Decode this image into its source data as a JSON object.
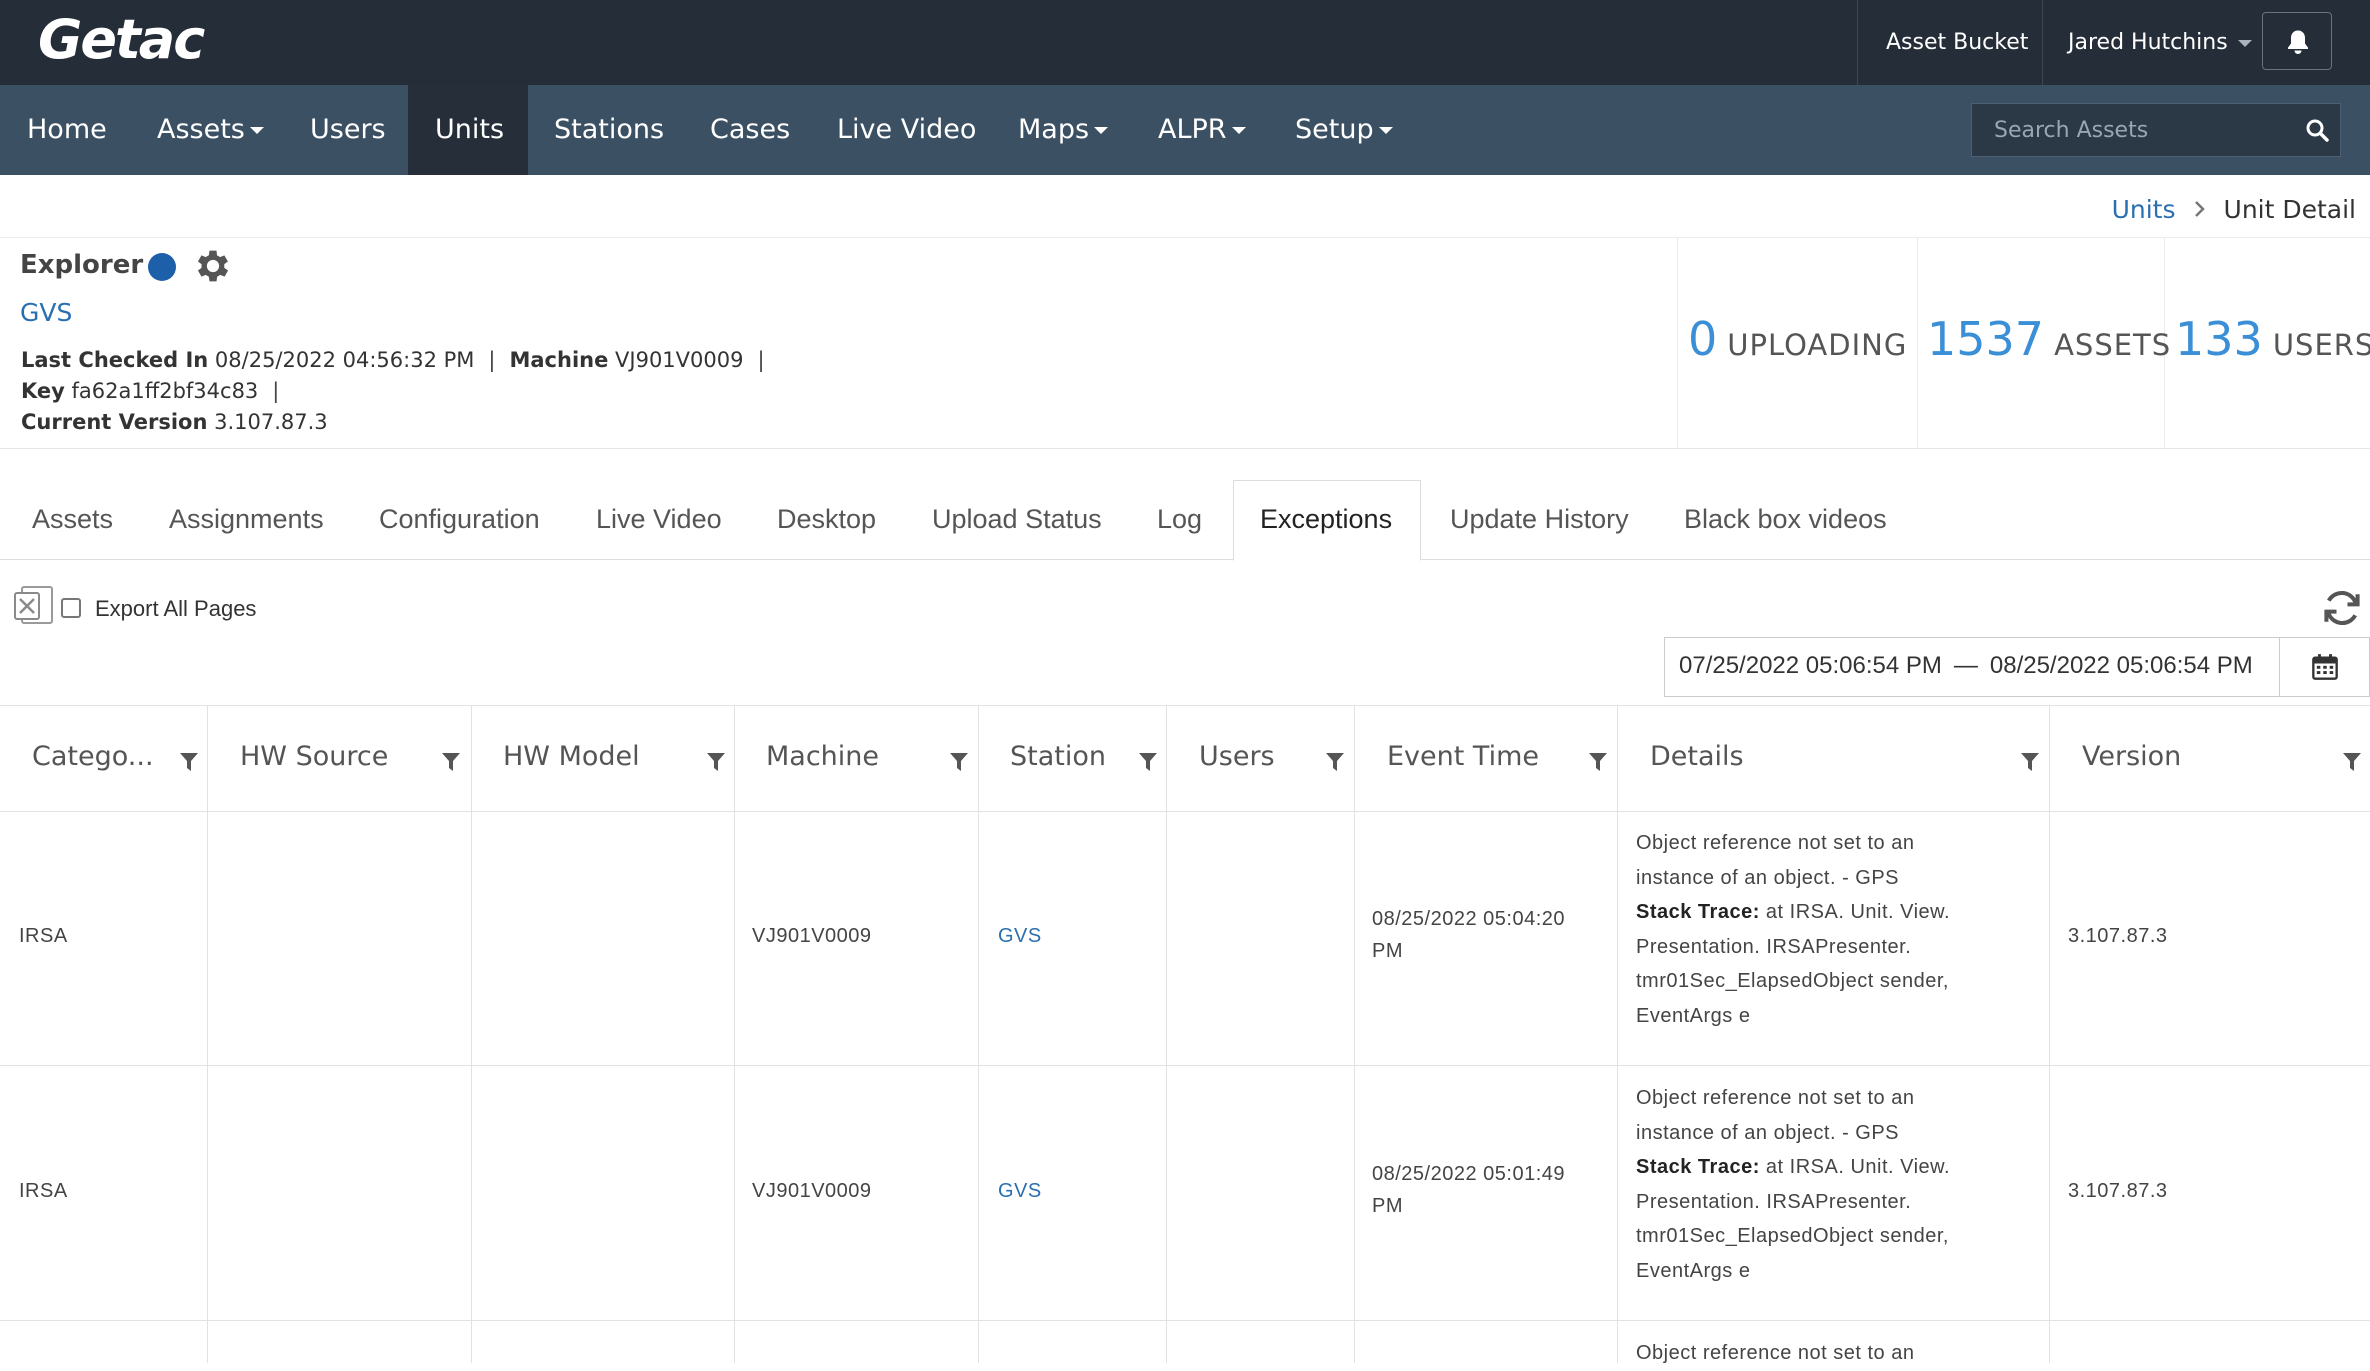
{
  "brand": "Getac",
  "topbar": {
    "asset_bucket": "Asset Bucket",
    "user_name": "Jared Hutchins"
  },
  "nav": {
    "items": [
      {
        "label": "Home",
        "dropdown": false
      },
      {
        "label": "Assets",
        "dropdown": true
      },
      {
        "label": "Users",
        "dropdown": false
      },
      {
        "label": "Units",
        "dropdown": false,
        "active": true
      },
      {
        "label": "Stations",
        "dropdown": false
      },
      {
        "label": "Cases",
        "dropdown": false
      },
      {
        "label": "Live Video",
        "dropdown": false
      },
      {
        "label": "Maps",
        "dropdown": true
      },
      {
        "label": "ALPR",
        "dropdown": true
      },
      {
        "label": "Setup",
        "dropdown": true
      }
    ],
    "search_placeholder": "Search Assets"
  },
  "breadcrumb": {
    "parent": "Units",
    "current": "Unit Detail"
  },
  "unit": {
    "name": "Explorer",
    "station": "GVS",
    "last_checked_in_label": "Last Checked In",
    "last_checked_in": "08/25/2022 04:56:32 PM",
    "machine_label": "Machine",
    "machine": "VJ901V0009",
    "key_label": "Key",
    "key": "fa62a1ff2bf34c83",
    "version_label": "Current Version",
    "version": "3.107.87.3",
    "separator": "|"
  },
  "stats": [
    {
      "value": "0",
      "label": "UPLOADING"
    },
    {
      "value": "1537",
      "label": "ASSETS"
    },
    {
      "value": "133",
      "label": "USERS"
    }
  ],
  "tabs": [
    "Assets",
    "Assignments",
    "Configuration",
    "Live Video",
    "Desktop",
    "Upload Status",
    "Log",
    "Exceptions",
    "Update History",
    "Black box videos"
  ],
  "active_tab": "Exceptions",
  "toolbar": {
    "export_all_label": "Export All Pages",
    "date_from": "07/25/2022 05:06:54 PM",
    "date_sep": "—",
    "date_to": "08/25/2022 05:06:54 PM"
  },
  "table": {
    "columns": [
      "Catego...",
      "HW Source",
      "HW Model",
      "Machine",
      "Station",
      "Users",
      "Event Time",
      "Details",
      "Version"
    ],
    "rows": [
      {
        "category": "IRSA",
        "hw_source": "",
        "hw_model": "",
        "machine": "VJ901V0009",
        "station": "GVS",
        "users": "",
        "event_time_1": "08/25/2022 05:04:20",
        "event_time_2": "PM",
        "details_1": "Object reference not set to an",
        "details_2": "instance of an object. - GPS",
        "details_stack_label": "Stack Trace:",
        "details_3": " at IRSA. Unit. View.",
        "details_4": "Presentation. IRSAPresenter.",
        "details_5": "tmr01Sec_ElapsedObject sender,",
        "details_6": "EventArgs e",
        "version": "3.107.87.3"
      },
      {
        "category": "IRSA",
        "hw_source": "",
        "hw_model": "",
        "machine": "VJ901V0009",
        "station": "GVS",
        "users": "",
        "event_time_1": "08/25/2022 05:01:49",
        "event_time_2": "PM",
        "details_1": "Object reference not set to an",
        "details_2": "instance of an object. - GPS",
        "details_stack_label": "Stack Trace:",
        "details_3": " at IRSA. Unit. View.",
        "details_4": "Presentation. IRSAPresenter.",
        "details_5": "tmr01Sec_ElapsedObject sender,",
        "details_6": "EventArgs e",
        "version": "3.107.87.3"
      },
      {
        "details_1": "Object reference not set to an"
      }
    ]
  },
  "colors": {
    "topbar_bg": "#252d38",
    "navbar_bg": "#3c5064",
    "nav_active_bg": "#252e39",
    "accent_blue": "#3a8fd6",
    "link_blue": "#2a6fb0",
    "status_dot": "#1d5fa8"
  },
  "icons": [
    "bell-icon",
    "search-icon",
    "gear-icon",
    "excel-export-icon",
    "refresh-icon",
    "calendar-icon",
    "filter-icon",
    "chevron-right-icon",
    "caret-down-icon"
  ]
}
